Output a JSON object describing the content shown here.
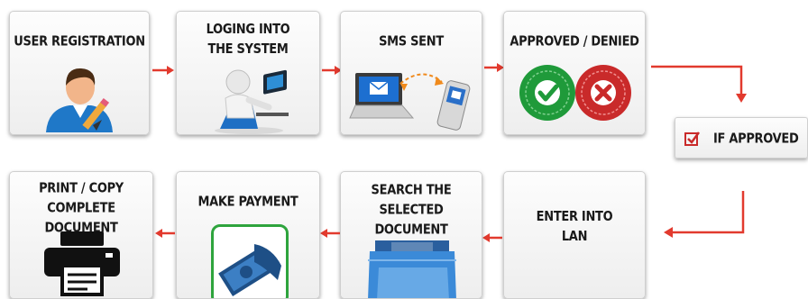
{
  "steps": {
    "user_registration": "USER REGISTRATION",
    "loging_into_system": "LOGING INTO\nTHE SYSTEM",
    "sms_sent": "SMS SENT",
    "approved_denied": "APPROVED / DENIED",
    "if_approved": "IF APPROVED",
    "enter_into_lan": "ENTER INTO\nLAN",
    "search_document": "SEARCH THE\nSELECTED DOCUMENT",
    "make_payment": "MAKE PAYMENT",
    "print_copy": "PRINT / COPY\nCOMPLETE DOCUMENT"
  },
  "icons": {
    "step1": "user-with-pencil-icon",
    "step2": "person-at-computer-icon",
    "step3": "laptop-phone-sms-icon",
    "step4": "approved-denied-seals-icon",
    "step5": "checkbox-icon",
    "step6": "none",
    "step7": "documents-folder-icon",
    "step8": "money-payment-icon",
    "step9": "printer-icon"
  },
  "colors": {
    "arrow": "#e23a2e",
    "approved": "#1f9a3a",
    "denied": "#c92a2a",
    "payment_border": "#2ea43d"
  }
}
